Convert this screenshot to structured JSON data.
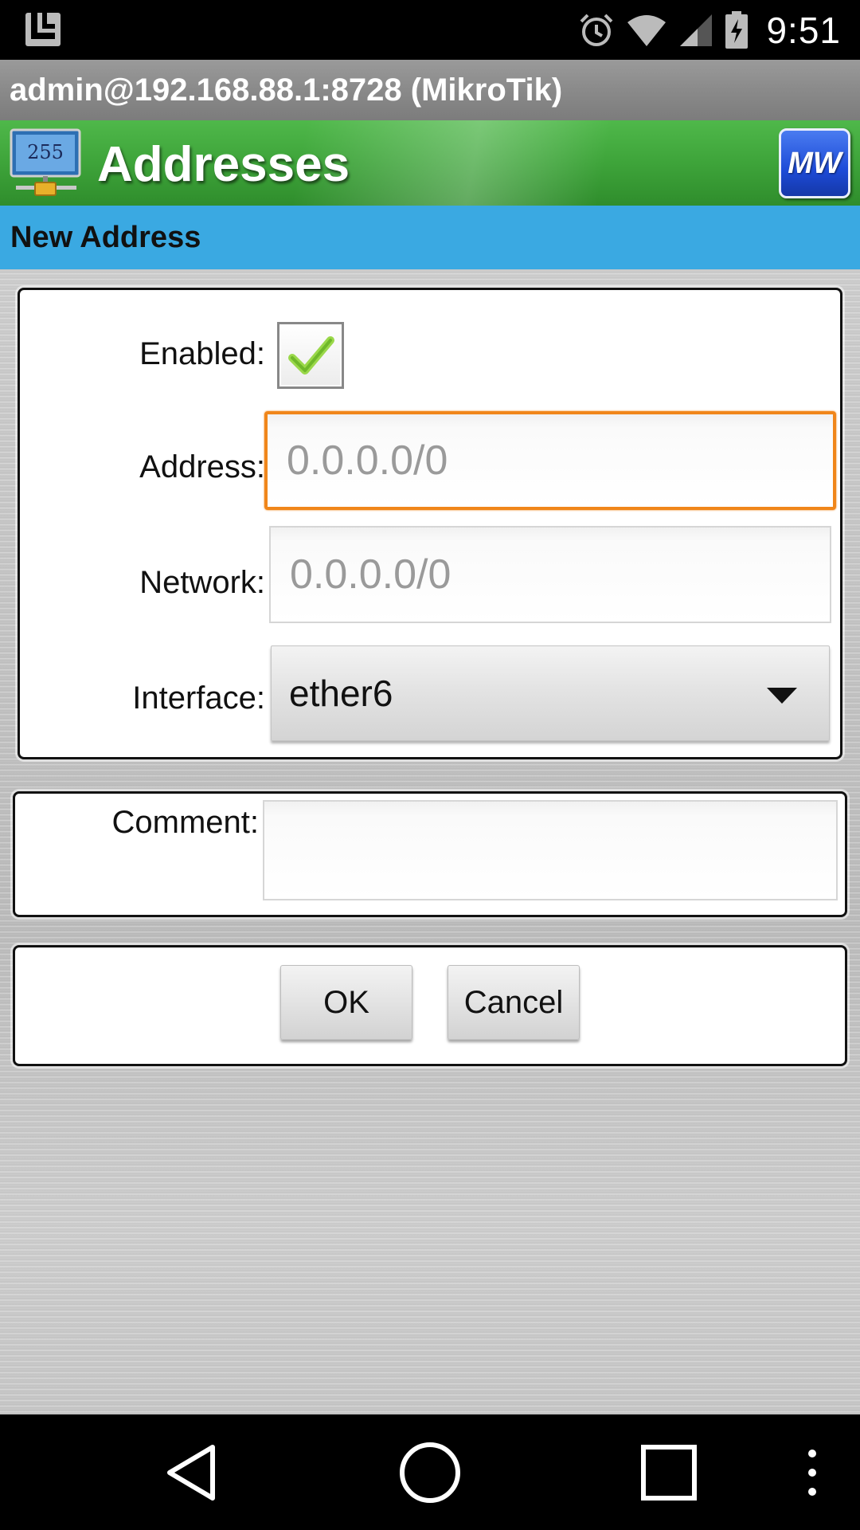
{
  "status_bar": {
    "time": "9:51",
    "icons": [
      "app-icon",
      "alarm-icon",
      "wifi-icon",
      "signal-icon",
      "battery-charging-icon"
    ]
  },
  "connection": {
    "title": "admin@192.168.88.1:8728 (MikroTik)"
  },
  "header": {
    "title": "Addresses",
    "icon_text": "255",
    "logo_text": "MW"
  },
  "section": {
    "title": "New Address"
  },
  "form": {
    "enabled_label": "Enabled:",
    "enabled_checked": true,
    "address_label": "Address:",
    "address_placeholder": "0.0.0.0/0",
    "network_label": "Network:",
    "network_placeholder": "0.0.0.0/0",
    "interface_label": "Interface:",
    "interface_value": "ether6",
    "comment_label": "Comment:",
    "comment_value": ""
  },
  "buttons": {
    "ok": "OK",
    "cancel": "Cancel"
  },
  "nav": {
    "icons": [
      "back-icon",
      "home-icon",
      "recents-icon",
      "overflow-menu-icon"
    ]
  },
  "colors": {
    "header_green": "#3ea43a",
    "section_blue": "#3aa9e2",
    "focus_orange": "#f0861a",
    "logo_blue": "#1d4bd8"
  }
}
